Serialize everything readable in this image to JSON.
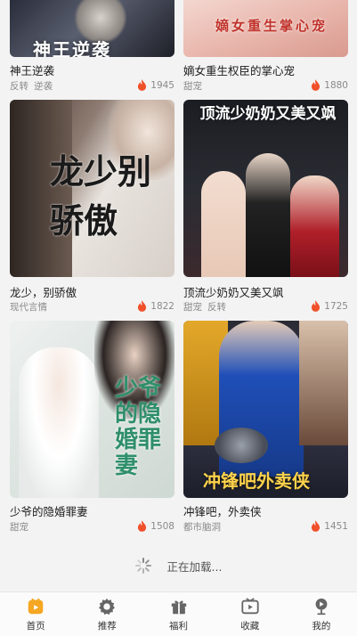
{
  "cards": [
    {
      "title": "神王逆袭",
      "tags": [
        "反转",
        "逆袭"
      ],
      "heat": "1945",
      "poster_text": "神王逆袭"
    },
    {
      "title": "嫡女重生权臣的掌心宠",
      "tags": [
        "甜宠"
      ],
      "heat": "1880",
      "poster_text": "嫡女重生掌心宠"
    },
    {
      "title": "龙少，别骄傲",
      "tags": [
        "现代言情"
      ],
      "heat": "1822",
      "poster_text": "龙少别骄傲"
    },
    {
      "title": "顶流少奶奶又美又飒",
      "tags": [
        "甜宠",
        "反转"
      ],
      "heat": "1725",
      "poster_text": "顶流少奶奶又美又飒"
    },
    {
      "title": "少爷的隐婚罪妻",
      "tags": [
        "甜宠"
      ],
      "heat": "1508",
      "poster_text": "少爷的隐婚罪妻"
    },
    {
      "title": "冲锋吧，外卖侠",
      "tags": [
        "都市脑洞"
      ],
      "heat": "1451",
      "poster_text": "冲锋吧外卖侠"
    }
  ],
  "loading_text": "正在加载...",
  "tabs": [
    {
      "label": "首页",
      "icon": "home-icon",
      "active": true
    },
    {
      "label": "推荐",
      "icon": "gear-icon",
      "active": false
    },
    {
      "label": "福利",
      "icon": "gift-icon",
      "active": false
    },
    {
      "label": "收藏",
      "icon": "tv-icon",
      "active": false
    },
    {
      "label": "我的",
      "icon": "profile-icon",
      "active": false
    }
  ],
  "colors": {
    "accent": "#f5a623",
    "flame": "#f0502a",
    "background": "#f3f3f3"
  }
}
